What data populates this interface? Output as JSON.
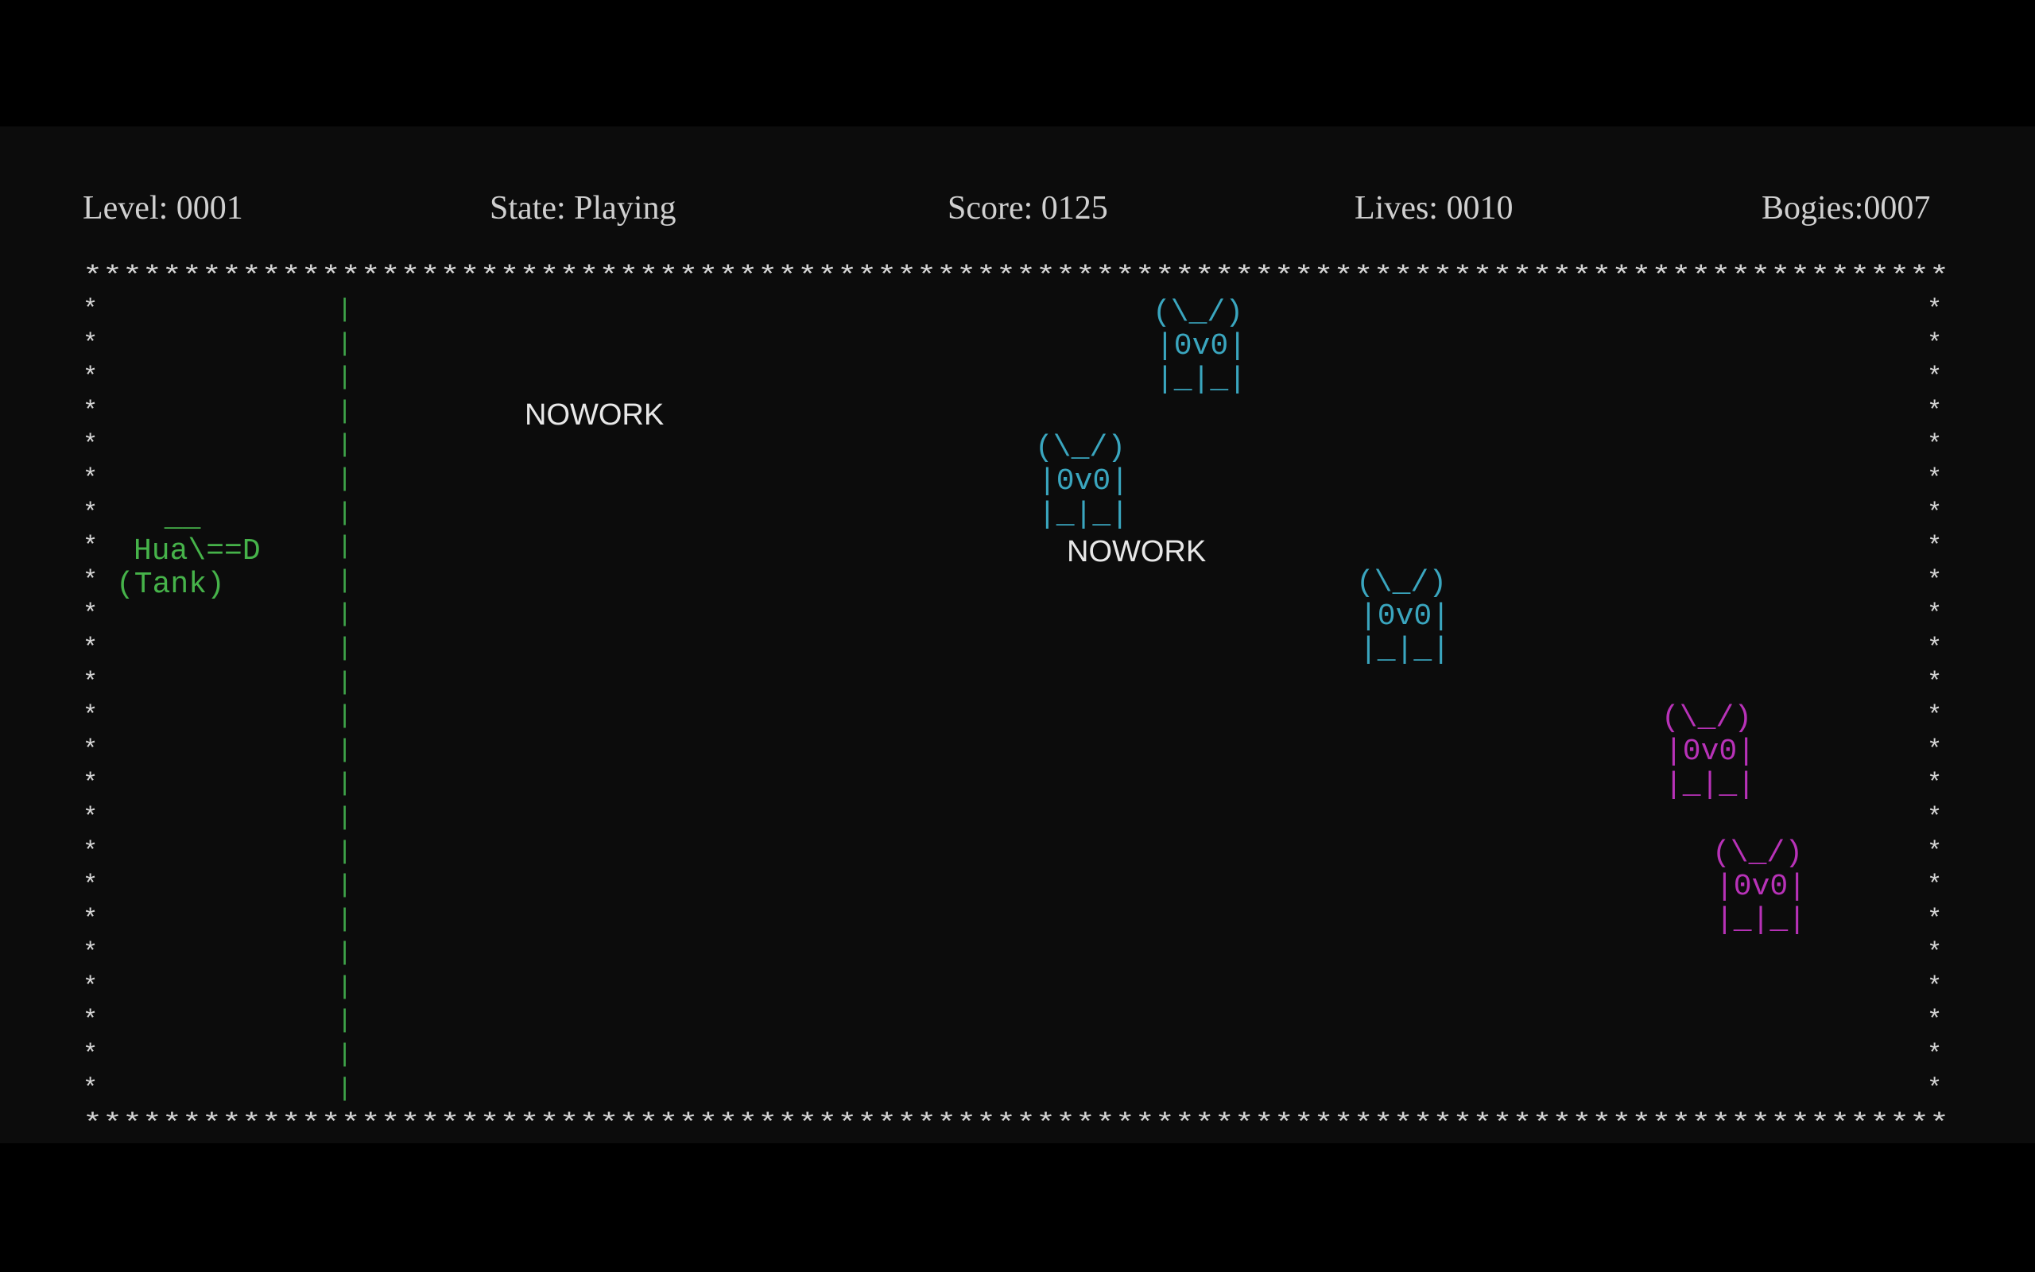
{
  "hud": {
    "level": "Level: 0001",
    "state": "State: Playing",
    "score": "Score: 0125",
    "lives": "Lives: 0010",
    "bogies": "Bogies:0007"
  },
  "tank": {
    "line1": " __",
    "line2": "Hua\\==D",
    "line3": "(Tank)",
    "color": "#46b34a"
  },
  "bogey_sprite": {
    "line1": "(\\_/)",
    "line2": "|0v0|",
    "line3": "|_|_|"
  },
  "bogeys": [
    {
      "color": "#3aa6bf"
    },
    {
      "color": "#3aa6bf"
    },
    {
      "color": "#3aa6bf"
    },
    {
      "color": "#b832b8"
    },
    {
      "color": "#b832b8"
    }
  ],
  "labels": {
    "nowork_1": "NOWORK",
    "nowork_2": "NOWORK"
  },
  "border_char": "*",
  "divider_char": "|"
}
